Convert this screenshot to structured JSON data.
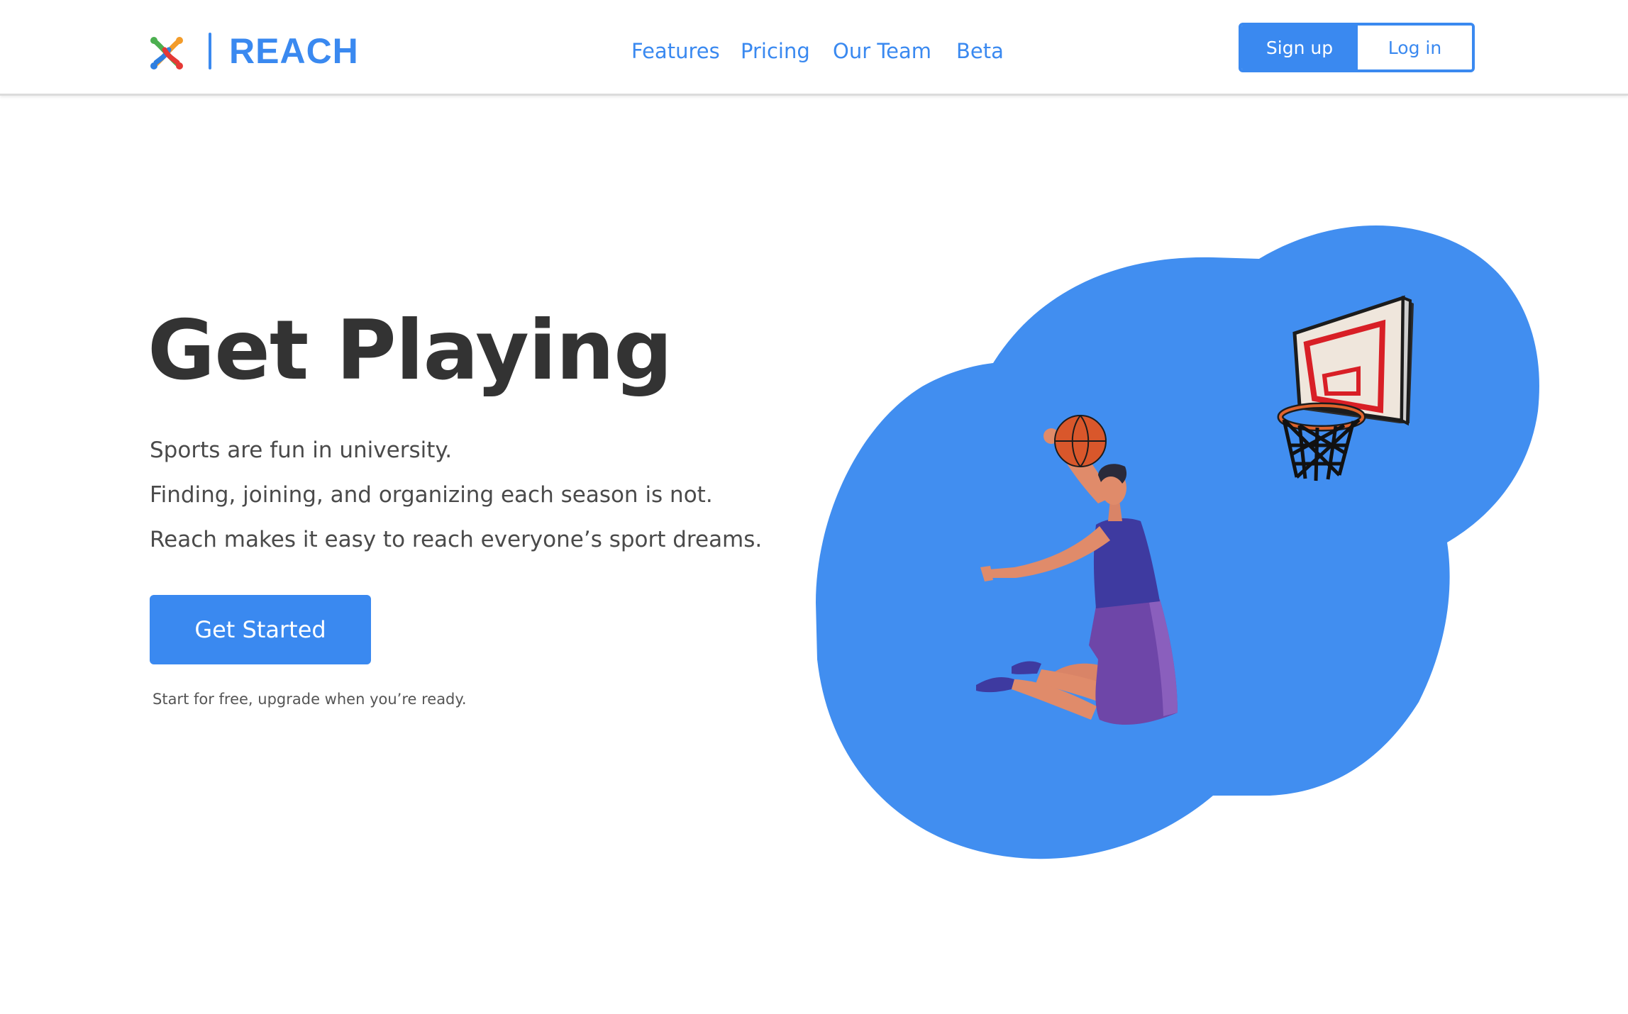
{
  "brand": {
    "name": "REACH",
    "logo_icon": "reach-logo-icon",
    "accent_color": "#3a89f0"
  },
  "nav": {
    "items": [
      {
        "label": "Features"
      },
      {
        "label": "Pricing"
      },
      {
        "label": "Our Team"
      },
      {
        "label": "Beta"
      }
    ]
  },
  "auth": {
    "signup_label": "Sign up",
    "login_label": "Log in"
  },
  "hero": {
    "title": "Get Playing",
    "lines": [
      "Sports are fun in university.",
      "Finding, joining, and organizing each season is not.",
      "Reach makes it easy to reach everyone’s sport dreams."
    ],
    "cta_label": "Get Started",
    "cta_note": "Start for free, upgrade when you’re ready."
  },
  "illustration": {
    "subject": "basketball-player-dunk-illustration",
    "background_color": "#418ef0"
  }
}
